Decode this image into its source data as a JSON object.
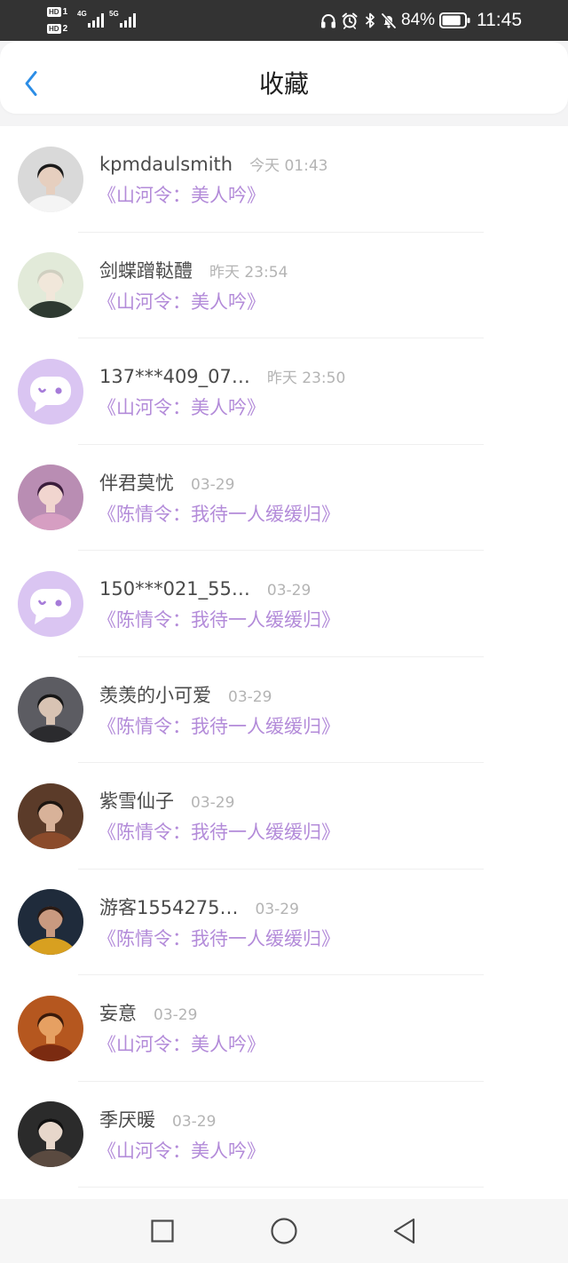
{
  "status_bar": {
    "sims": [
      {
        "badge": "HD",
        "number": "1"
      },
      {
        "badge": "HD",
        "number": "2"
      }
    ],
    "signal": [
      {
        "label": "4G",
        "level": 4,
        "max": 4
      },
      {
        "label": "5G",
        "level": 4,
        "max": 4
      }
    ],
    "icons": [
      "headphones-icon",
      "alarm-icon",
      "bluetooth-icon",
      "bell-off-icon"
    ],
    "battery_percent": "84%",
    "battery_level": 0.84,
    "time": "11:45"
  },
  "header": {
    "back_icon": "chevron-left-icon",
    "title": "收藏"
  },
  "colors": {
    "status_bar_bg": "#333333",
    "page_bg": "#f4f4f5",
    "header_bg": "#ffffff",
    "back_arrow": "#2b8de6",
    "title_text": "#1e1e1e",
    "name_text": "#4a4a4a",
    "time_text": "#b4b4b4",
    "work_title": "#b38bd9",
    "divider": "#efefef",
    "default_avatar_bg": "#dac5f2",
    "default_avatar_face": "#a67bd9",
    "nav_bar_bg": "#f6f6f6",
    "nav_icon": "#4a4a4a"
  },
  "list": {
    "items": [
      {
        "name": "kpmdaulsmith",
        "time": "今天 01:43",
        "work": "《山河令：美人吟》",
        "avatar": {
          "type": "photo",
          "colors": [
            "#d9d9d9",
            "#1b1b1b",
            "#e6cfbf",
            "#f4f4f4"
          ]
        }
      },
      {
        "name": "剑蝶蹭鞑醴",
        "time": "昨天 23:54",
        "work": "《山河令：美人吟》",
        "avatar": {
          "type": "photo",
          "colors": [
            "#e2ead9",
            "#cfcfc0",
            "#f1e7da",
            "#2e3a31"
          ]
        }
      },
      {
        "name": "137***409_07…",
        "time": "昨天 23:50",
        "work": "《山河令：美人吟》",
        "avatar": {
          "type": "default"
        }
      },
      {
        "name": "伴君莫忧",
        "time": "03-29",
        "work": "《陈情令：我待一人缓缓归》",
        "avatar": {
          "type": "photo",
          "colors": [
            "#b98db3",
            "#3b1d3c",
            "#f1d5cf",
            "#d69ec2"
          ]
        }
      },
      {
        "name": "150***021_55…",
        "time": "03-29",
        "work": "《陈情令：我待一人缓缓归》",
        "avatar": {
          "type": "default"
        }
      },
      {
        "name": "羡羡的小可爱",
        "time": "03-29",
        "work": "《陈情令：我待一人缓缓归》",
        "avatar": {
          "type": "photo",
          "colors": [
            "#5c5c62",
            "#161616",
            "#d8c3b3",
            "#2b2b2e"
          ]
        }
      },
      {
        "name": "紫雪仙子",
        "time": "03-29",
        "work": "《陈情令：我待一人缓缓归》",
        "avatar": {
          "type": "photo",
          "colors": [
            "#5b3b29",
            "#1d1510",
            "#d8b299",
            "#8b4b2b"
          ]
        }
      },
      {
        "name": "游客1554275…",
        "time": "03-29",
        "work": "《陈情令：我待一人缓缓归》",
        "avatar": {
          "type": "photo",
          "colors": [
            "#1f2b3b",
            "#2a1a14",
            "#c99a80",
            "#d8a020"
          ]
        }
      },
      {
        "name": "妄意",
        "time": "03-29",
        "work": "《山河令：美人吟》",
        "avatar": {
          "type": "photo",
          "colors": [
            "#b5571f",
            "#3a1a0a",
            "#e6a062",
            "#7b2b11"
          ]
        }
      },
      {
        "name": "季厌暖",
        "time": "03-29",
        "work": "《山河令：美人吟》",
        "avatar": {
          "type": "photo",
          "colors": [
            "#2b2b2b",
            "#111111",
            "#e7d7cb",
            "#5a4a40"
          ]
        }
      }
    ]
  },
  "nav_bar": {
    "icons": [
      "square-icon",
      "circle-icon",
      "triangle-back-icon"
    ]
  }
}
